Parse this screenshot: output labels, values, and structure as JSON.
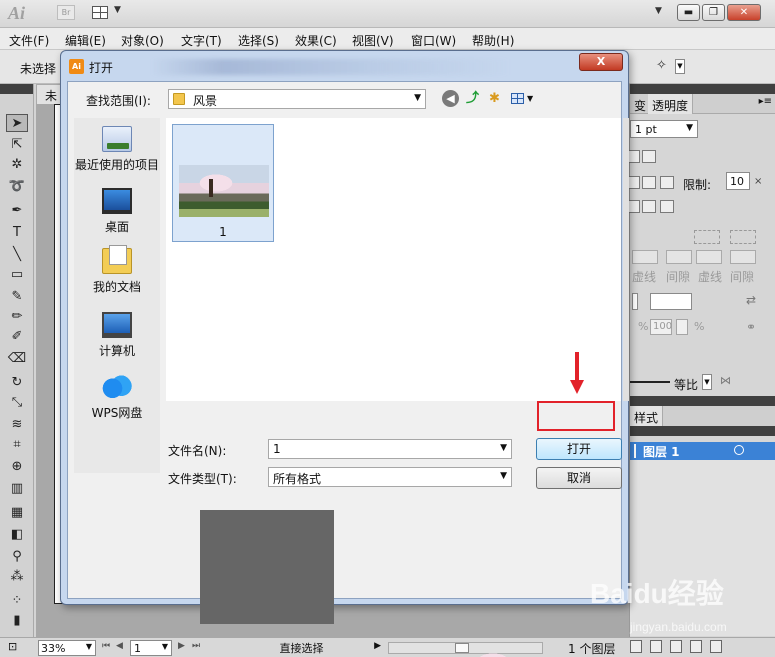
{
  "app": {
    "logo_text": "Ai",
    "bridge_text": "Br"
  },
  "menubar": [
    "文件(F)",
    "编辑(E)",
    "对象(O)",
    "文字(T)",
    "选择(S)",
    "效果(C)",
    "视图(V)",
    "窗口(W)",
    "帮助(H)"
  ],
  "control_bar": {
    "no_selection": "未选择"
  },
  "doc_tab": {
    "label": "未"
  },
  "right_panel": {
    "tab_partial": "变",
    "tab_transparency": "透明度",
    "weight_value": "1 pt",
    "limit_label": "限制:",
    "limit_value": "10",
    "dash_labels": [
      "虚线",
      "间隙",
      "虚线",
      "间隙"
    ],
    "pct_value": "100",
    "pct_sign": "%",
    "ratio_label": "等比",
    "styles_tab_partial": "样式",
    "layer_name": "图层 1",
    "layer_count": "1 个图层"
  },
  "statusbar": {
    "zoom": "33%",
    "page": "1",
    "mode": "直接选择"
  },
  "dialog": {
    "title": "打开",
    "close_label": "X",
    "look_in_label": "查找范围(I):",
    "look_in_value": "风景",
    "places": [
      "最近使用的项目",
      "桌面",
      "我的文档",
      "计算机",
      "WPS网盘"
    ],
    "files": [
      {
        "name": "1"
      }
    ],
    "filename_label": "文件名(N):",
    "filename_value": "1",
    "filetype_label": "文件类型(T):",
    "filetype_value": "所有格式",
    "open_button": "打开",
    "cancel_button": "取消"
  },
  "watermark": {
    "main": "Baidu经验",
    "sub": "jingyan.baidu.com"
  },
  "colors": {
    "highlight_red": "#e2222a",
    "layer_blue": "#3b82d6",
    "dialog_frame": "#c6d7ee"
  }
}
